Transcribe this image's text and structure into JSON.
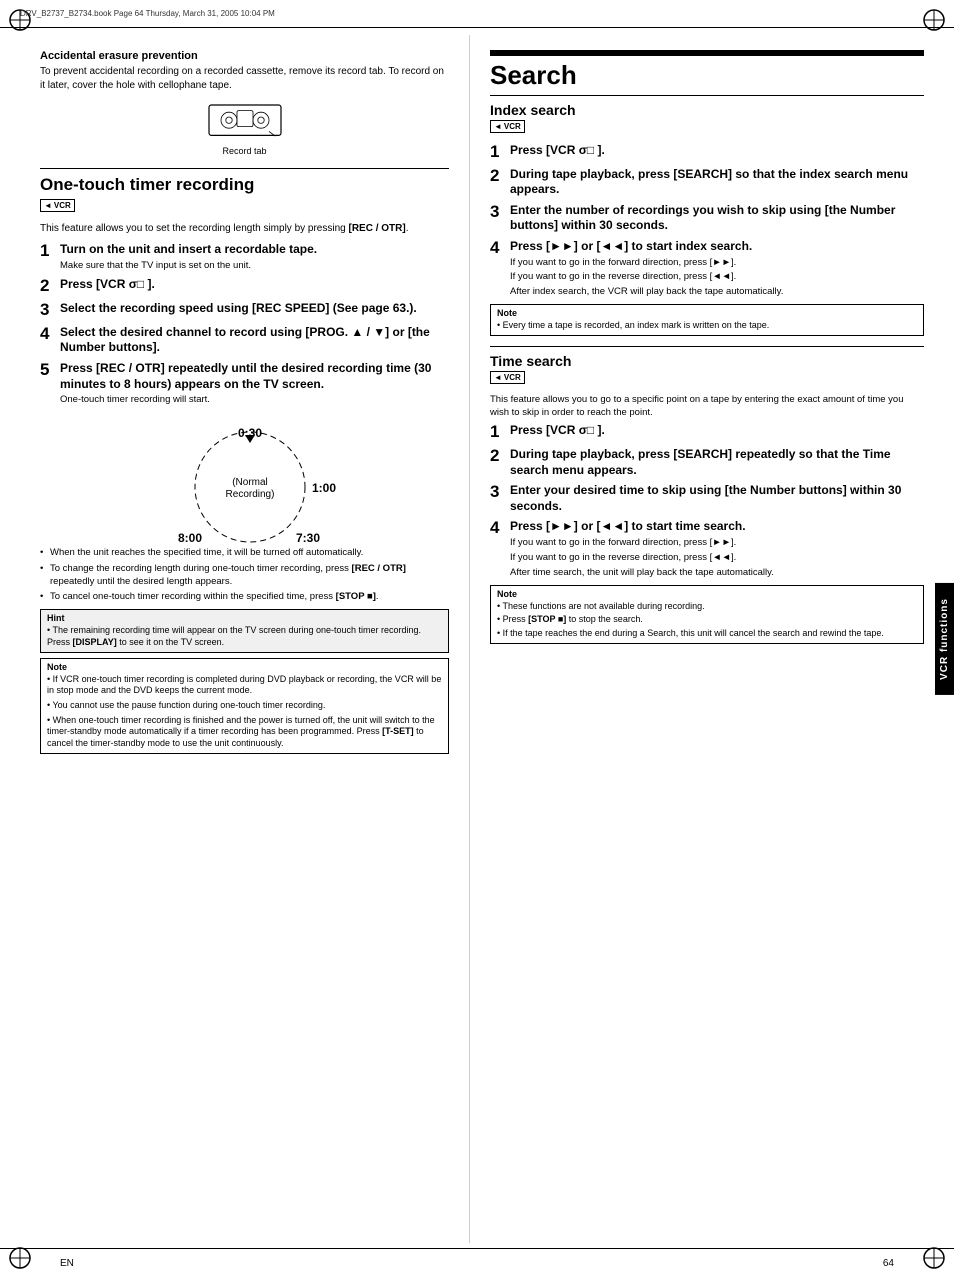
{
  "meta": {
    "file_info": "DRV_B2737_B2734.book  Page 64  Thursday, March 31, 2005  10:04 PM",
    "page_label": "EN",
    "page_num": "64",
    "side_tab": "VCR functions"
  },
  "left": {
    "erasure": {
      "title": "Accidental erasure prevention",
      "body": "To prevent accidental recording on a recorded cassette, remove its record tab. To record on it later, cover the hole with cellophane tape.",
      "diagram_label": "Record tab"
    },
    "otr": {
      "title": "One-touch timer recording",
      "badge": "VCR",
      "intro": "This feature allows you to set the recording length simply by pressing [REC / OTR].",
      "steps": [
        {
          "num": "1",
          "title": "Turn on the unit and insert a recordable tape.",
          "detail": "Make sure that the TV input is set on the unit."
        },
        {
          "num": "2",
          "title": "Press [VCR σ□ ].",
          "detail": ""
        },
        {
          "num": "3",
          "title": "Select the recording speed using [REC SPEED] (See page 63.).",
          "detail": ""
        },
        {
          "num": "4",
          "title": "Select the desired channel to record using [PROG. ▲ / ▼] or [the Number buttons].",
          "detail": ""
        },
        {
          "num": "5",
          "title": "Press [REC / OTR] repeatedly until the desired recording time (30 minutes to 8 hours) appears on the TV screen.",
          "detail": "One-touch timer recording will start."
        }
      ],
      "dial": {
        "label_top": "0:30",
        "label_right": "1:00",
        "label_bottom_left": "8:00",
        "label_bottom_right": "7:30",
        "label_center": "(Normal Recording)"
      },
      "bullets": [
        "When the unit reaches the specified time, it will be turned off automatically.",
        "To change the recording length during one-touch timer recording, press [REC / OTR] repeatedly until the desired length appears.",
        "To cancel one-touch timer recording within the specified time, press [STOP ■]."
      ],
      "hint": {
        "title": "Hint",
        "content": "The remaining recording time will appear on the TV screen during one-touch timer recording. Press [DISPLAY] to see it on the TV screen."
      },
      "note": {
        "title": "Note",
        "items": [
          "If VCR one-touch timer recording is completed during DVD playback or recording, the VCR will be in stop mode and the DVD keeps the current mode.",
          "You cannot use the pause function during one-touch timer recording.",
          "When one-touch timer recording is finished and the power is turned off, the unit will switch to the timer-standby mode automatically if a timer recording has been programmed. Press [T-SET] to cancel the timer-standby mode to use the unit continuously."
        ]
      }
    }
  },
  "right": {
    "search": {
      "heading": "Search",
      "index_search": {
        "title": "Index search",
        "badge": "VCR",
        "steps": [
          {
            "num": "1",
            "title": "Press [VCR σ□ ].",
            "detail": ""
          },
          {
            "num": "2",
            "title": "During tape playback, press [SEARCH] so that the index search menu appears.",
            "detail": ""
          },
          {
            "num": "3",
            "title": "Enter the number of recordings you wish to skip using [the Number buttons] within 30 seconds.",
            "detail": ""
          },
          {
            "num": "4",
            "title": "Press [►►] or [◄◄] to start index search.",
            "detail_items": [
              "If you want to go in the forward direction, press [►►].",
              "If you want to go in the reverse direction, press [◄◄].",
              "After index search, the VCR will play back the tape automatically."
            ]
          }
        ],
        "note": {
          "title": "Note",
          "content": "Every time a tape is recorded, an index mark is written on the tape."
        }
      },
      "time_search": {
        "title": "Time search",
        "badge": "VCR",
        "intro": "This feature allows you to go to a specific point on a tape by entering the exact amount of time you wish to skip in order to reach the point.",
        "steps": [
          {
            "num": "1",
            "title": "Press [VCR σ□ ].",
            "detail": ""
          },
          {
            "num": "2",
            "title": "During tape playback, press [SEARCH] repeatedly so that the Time search menu appears.",
            "detail": ""
          },
          {
            "num": "3",
            "title": "Enter your desired time to skip using [the Number buttons] within 30 seconds.",
            "detail": ""
          },
          {
            "num": "4",
            "title": "Press [►►] or [◄◄] to start time search.",
            "detail_items": [
              "If you want to go in the forward direction, press [►►].",
              "If you want to go in the reverse direction, press [◄◄].",
              "After time search, the unit will play back the tape automatically."
            ]
          }
        ],
        "note": {
          "title": "Note",
          "items": [
            "These functions are not available during recording.",
            "Press [STOP ■] to stop the search.",
            "If the tape reaches the end during a Search, this unit will cancel the search and rewind the tape."
          ]
        }
      }
    }
  }
}
